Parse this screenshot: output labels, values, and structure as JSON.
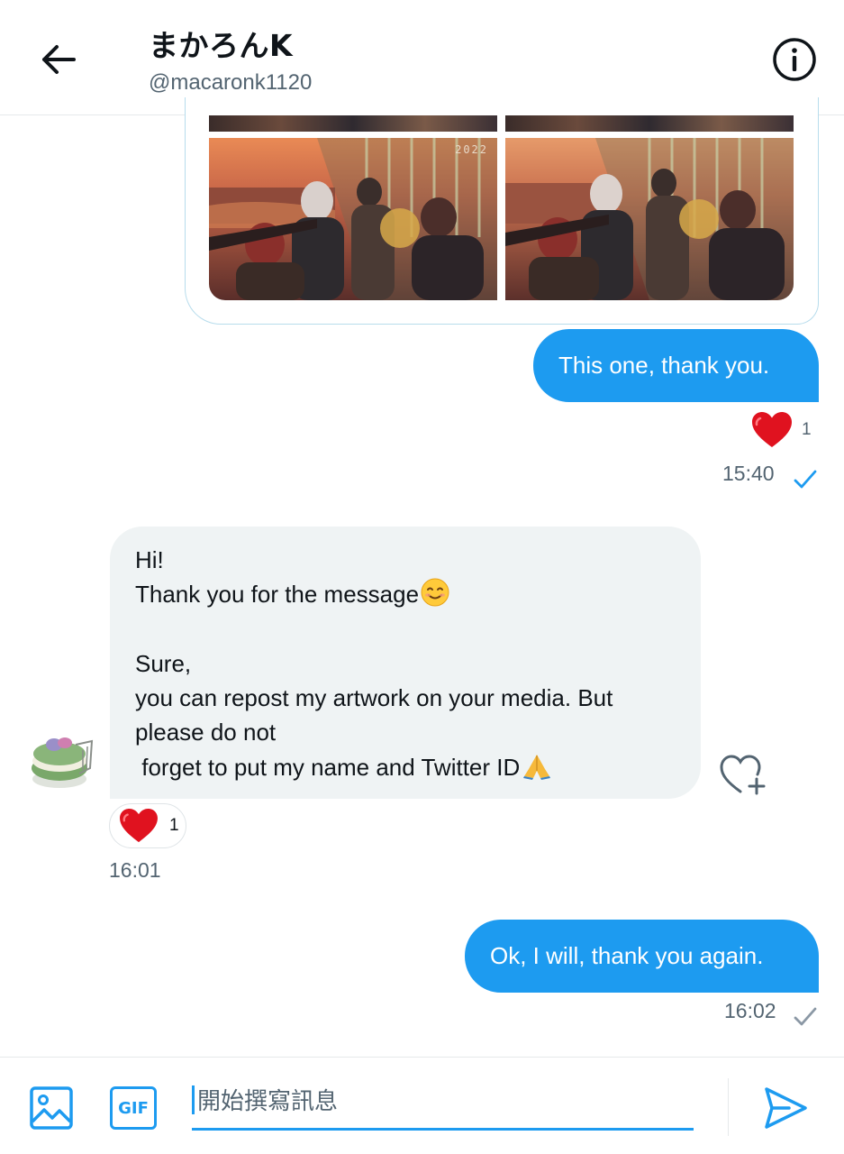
{
  "header": {
    "name": "まかろんK",
    "handle": "@macaronk1120"
  },
  "icons": {
    "back": "back-arrow-icon",
    "info": "info-icon",
    "heart": "heart-emoji-icon",
    "add_reaction": "heart-plus-icon",
    "check": "checkmark-icon",
    "media": "image-icon",
    "send": "send-icon"
  },
  "shared_media": {
    "year_label": "2022"
  },
  "messages": {
    "out1": {
      "text": "This one, thank you.",
      "reaction_count": "1",
      "time": "15:40"
    },
    "in1": {
      "lines": [
        "Hi!",
        "Thank you for the message",
        "",
        "Sure,",
        "you can repost my artwork on your media. But",
        "please do not",
        " forget to put my name and Twitter ID"
      ],
      "reaction_count": "1",
      "time": "16:01"
    },
    "out2": {
      "text": "Ok, I will, thank you again.",
      "time": "16:02"
    }
  },
  "composer": {
    "gif_label": "GIF",
    "placeholder": "開始撰寫訊息"
  },
  "colors": {
    "accent": "#1d9bf0",
    "bubble_in": "#eff3f4",
    "muted_text": "#536471",
    "heart": "#e0121f"
  }
}
